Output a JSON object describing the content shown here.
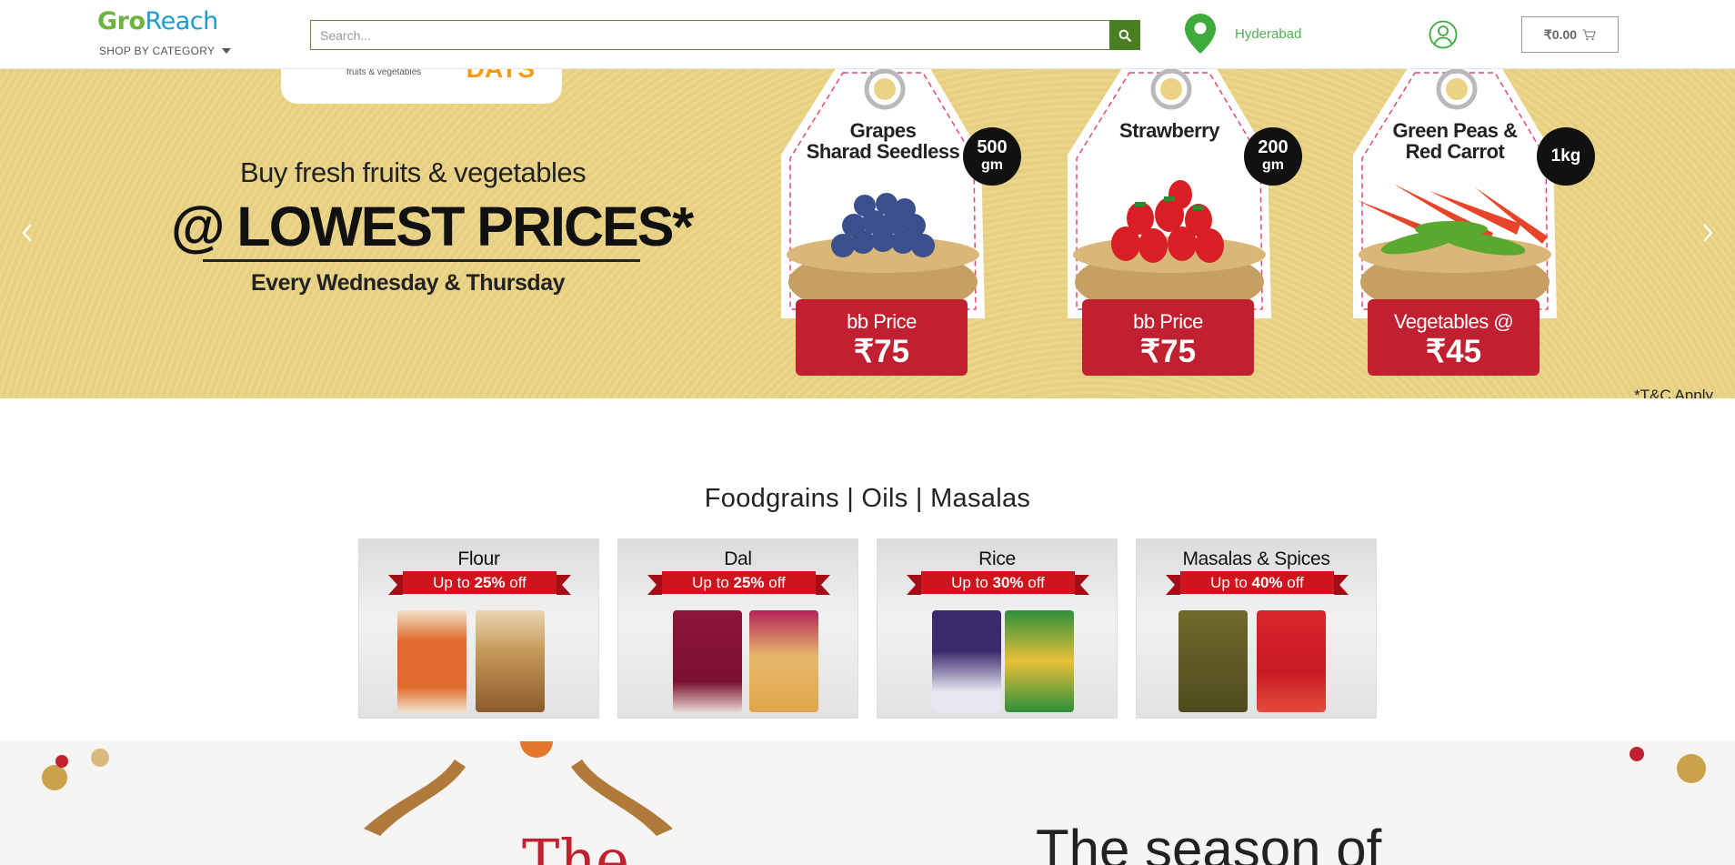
{
  "header": {
    "logo_part1": "Gro",
    "logo_part2": "Reach",
    "shop_by_category": "SHOP BY CATEGORY",
    "search_placeholder": "Search...",
    "location": "Hyderabad",
    "cart_total": "₹0.00"
  },
  "banner": {
    "pill_small": "fruits & vegetables",
    "pill_days": "DAYS",
    "line1": "Buy fresh fruits & vegetables",
    "line2": "@ LOWEST PRICES*",
    "line3": "Every Wednesday & Thursday",
    "tnc": "*T&C Apply",
    "tags": [
      {
        "name": "Grapes\nSharad Seedless",
        "badge_top": "500",
        "badge_bottom": "gm",
        "price_label": "bb Price",
        "price_value": "₹75"
      },
      {
        "name": "Strawberry",
        "badge_top": "200",
        "badge_bottom": "gm",
        "price_label": "bb Price",
        "price_value": "₹75"
      },
      {
        "name": "Green  Peas &\nRed Carrot",
        "badge_top": "1kg",
        "badge_bottom": "",
        "price_label": "Vegetables @",
        "price_value": "₹45"
      }
    ]
  },
  "section": {
    "title": "Foodgrains | Oils | Masalas",
    "categories": [
      {
        "name": "Flour",
        "offer_prefix": "Up to ",
        "offer_pct": "25%",
        "offer_suffix": " off"
      },
      {
        "name": "Dal",
        "offer_prefix": "Up to ",
        "offer_pct": "25%",
        "offer_suffix": " off"
      },
      {
        "name": "Rice",
        "offer_prefix": "Up to ",
        "offer_pct": "30%",
        "offer_suffix": " off"
      },
      {
        "name": "Masalas & Spices",
        "offer_prefix": "Up to ",
        "offer_pct": "40%",
        "offer_suffix": " off"
      }
    ]
  },
  "promo": {
    "text_left": "The",
    "text_right": "The season of"
  },
  "colors": {
    "brand_green": "#6db33f",
    "brand_blue": "#1c9bd1",
    "search_button": "#4a7e23",
    "banner_bg": "#ead384",
    "price_red": "#c0202f"
  },
  "icons": [
    "search-icon",
    "location-pin-icon",
    "user-account-icon",
    "cart-icon",
    "chevron-left-icon",
    "chevron-right-icon"
  ]
}
